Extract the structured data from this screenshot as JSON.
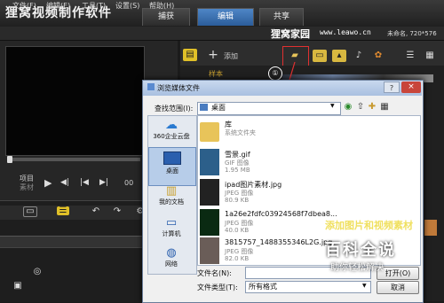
{
  "app": {
    "title": "狸窝视频制作软件",
    "tabs": [
      {
        "label": "捕获",
        "active": false
      },
      {
        "label": "编辑",
        "active": true
      },
      {
        "label": "共享",
        "active": false
      }
    ],
    "menu": [
      "文件(F)",
      "编辑(E)",
      "工具(T)",
      "设置(S)",
      "帮助(H)"
    ],
    "site_name": "狸窝家园",
    "site_url": "www.leawo.cn",
    "project_info": "未命名, 720*576"
  },
  "left_panel": {
    "project_label": "项目",
    "clip_label": "素材",
    "timecode": "00"
  },
  "library": {
    "add_label": "添加",
    "sample_label": "样本",
    "step_marker": "①"
  },
  "dialog": {
    "title": "浏览媒体文件",
    "help_symbol": "?",
    "close_symbol": "×",
    "look_in_label": "查找范围(I):",
    "look_in_value": "桌面",
    "places": [
      {
        "label": "360企业云盘",
        "icon": "cloud-icon",
        "active": false
      },
      {
        "label": "桌面",
        "icon": "desktop-icon",
        "active": true
      },
      {
        "label": "我的文档",
        "icon": "documents-icon",
        "active": false
      },
      {
        "label": "计算机",
        "icon": "computer-icon",
        "active": false
      },
      {
        "label": "网络",
        "icon": "network-icon",
        "active": false
      }
    ],
    "files": [
      {
        "name": "库",
        "type": "系统文件夹",
        "size": "",
        "icon": "folder-icon",
        "color": "#e8c45a"
      },
      {
        "name": "雪景.gif",
        "type": "GIF 图像",
        "size": "1.95 MB",
        "icon": "image-icon",
        "color": "#2c5f8a"
      },
      {
        "name": "ipad图片素材.jpg",
        "type": "JPEG 图像",
        "size": "80.9 KB",
        "icon": "image-icon",
        "color": "#222222"
      },
      {
        "name": "1a26e2fdfc03924568f7dbea8...",
        "type": "JPEG 图像",
        "size": "40.0 KB",
        "icon": "image-icon",
        "color": "#0a2a12"
      },
      {
        "name": "3815757_1488355346L2G.jpg",
        "type": "JPEG 图像",
        "size": "82.0 KB",
        "icon": "image-icon",
        "color": "#6a5d58"
      }
    ],
    "filename_label": "文件名(N):",
    "filename_value": "",
    "filetype_label": "文件类型(T):",
    "filetype_value": "所有格式",
    "open_label": "打开(O)",
    "cancel_label": "取消"
  },
  "annotation": {
    "text": "添加图片和视频素材",
    "watermark_title": "百科全说",
    "watermark_sub": "助你轻松解决"
  }
}
